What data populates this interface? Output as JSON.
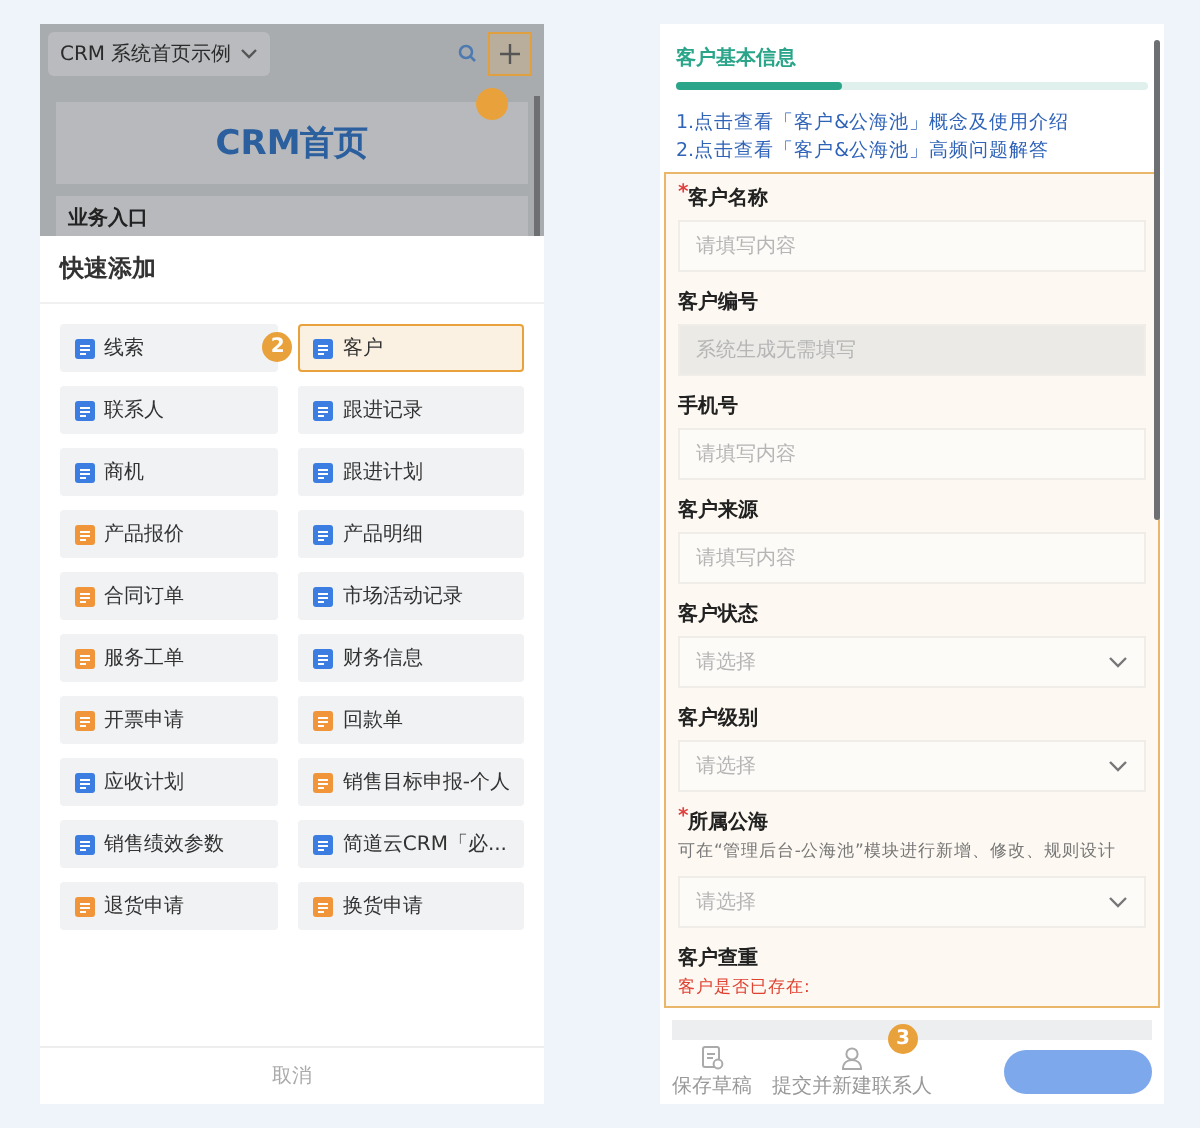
{
  "left_phone": {
    "header": {
      "title": "CRM 系统首页示例"
    },
    "banner": "CRM首页",
    "section": "业务入口",
    "step_badge": "2",
    "sheet": {
      "title": "快速添加",
      "cancel": "取消",
      "items": [
        {
          "label": "线索",
          "color": "#3b7de0",
          "selected": false
        },
        {
          "label": "客户",
          "color": "#3b7de0",
          "selected": true
        },
        {
          "label": "联系人",
          "color": "#3b7de0",
          "selected": false
        },
        {
          "label": "跟进记录",
          "color": "#3b7de0",
          "selected": false
        },
        {
          "label": "商机",
          "color": "#3b7de0",
          "selected": false
        },
        {
          "label": "跟进计划",
          "color": "#3b7de0",
          "selected": false
        },
        {
          "label": "产品报价",
          "color": "#f0953a",
          "selected": false
        },
        {
          "label": "产品明细",
          "color": "#3b7de0",
          "selected": false
        },
        {
          "label": "合同订单",
          "color": "#f0953a",
          "selected": false
        },
        {
          "label": "市场活动记录",
          "color": "#3b7de0",
          "selected": false
        },
        {
          "label": "服务工单",
          "color": "#f0953a",
          "selected": false
        },
        {
          "label": "财务信息",
          "color": "#3b7de0",
          "selected": false
        },
        {
          "label": "开票申请",
          "color": "#f0953a",
          "selected": false
        },
        {
          "label": "回款单",
          "color": "#f0953a",
          "selected": false
        },
        {
          "label": "应收计划",
          "color": "#3b7de0",
          "selected": false
        },
        {
          "label": "销售目标申报-个人",
          "color": "#f0953a",
          "selected": false
        },
        {
          "label": "销售绩效参数",
          "color": "#3b7de0",
          "selected": false
        },
        {
          "label": "简道云CRM「必...",
          "color": "#3b7de0",
          "selected": false
        },
        {
          "label": "退货申请",
          "color": "#f0953a",
          "selected": false
        },
        {
          "label": "换货申请",
          "color": "#f0953a",
          "selected": false
        }
      ]
    }
  },
  "right_phone": {
    "title": "客户基本信息",
    "links": [
      "1.点击查看「客户&公海池」概念及使用介绍",
      "2.点击查看「客户&公海池」高频问题解答"
    ],
    "fields": [
      {
        "kind": "text",
        "label": "客户名称",
        "required_mark": "*",
        "placeholder": "请填写内容"
      },
      {
        "kind": "disabled",
        "label": "客户编号",
        "placeholder": "系统生成无需填写"
      },
      {
        "kind": "text",
        "label": "手机号",
        "placeholder": "请填写内容"
      },
      {
        "kind": "text",
        "label": "客户来源",
        "placeholder": "请填写内容"
      },
      {
        "kind": "select",
        "label": "客户状态",
        "placeholder": "请选择"
      },
      {
        "kind": "select",
        "label": "客户级别",
        "placeholder": "请选择"
      },
      {
        "kind": "select",
        "label": "所属公海",
        "required_mark": "*",
        "hint": "可在“管理后台-公海池”模块进行新增、修改、规则设计",
        "placeholder": "请选择"
      },
      {
        "kind": "check",
        "label": "客户查重",
        "note": "客户是否已存在:"
      }
    ],
    "step_badge": "3",
    "toolbar": [
      {
        "kind": "draft",
        "label": "保存草稿"
      },
      {
        "kind": "contact",
        "label": "提交并新建联系人"
      }
    ]
  }
}
